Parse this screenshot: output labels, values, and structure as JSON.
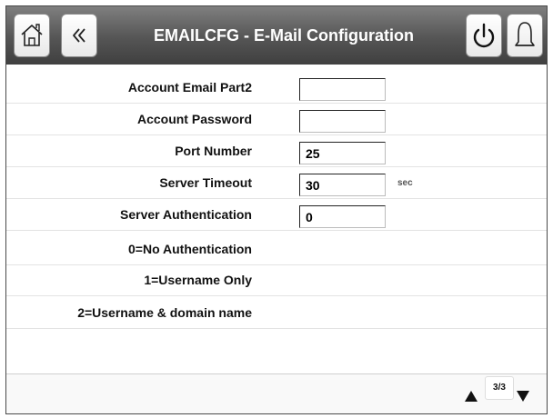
{
  "header": {
    "title": "EMAILCFG - E-Mail Configuration",
    "icons": {
      "home": "home-icon",
      "back": "back-icon",
      "power": "power-icon",
      "alarm": "bell-icon"
    }
  },
  "params": [
    {
      "label": "Account Email Part2",
      "value": "",
      "unit": ""
    },
    {
      "label": "Account Password",
      "value": "",
      "unit": ""
    },
    {
      "label": "Port Number",
      "value": "25",
      "unit": ""
    },
    {
      "label": "Server Timeout",
      "value": "30",
      "unit": "sec"
    },
    {
      "label": "Server Authentication",
      "value": "0",
      "unit": ""
    },
    {
      "label": "0=No Authentication"
    },
    {
      "label": "1=Username Only"
    },
    {
      "label": "2=Username & domain name"
    }
  ],
  "footer": {
    "page_indicator": "3/3"
  }
}
